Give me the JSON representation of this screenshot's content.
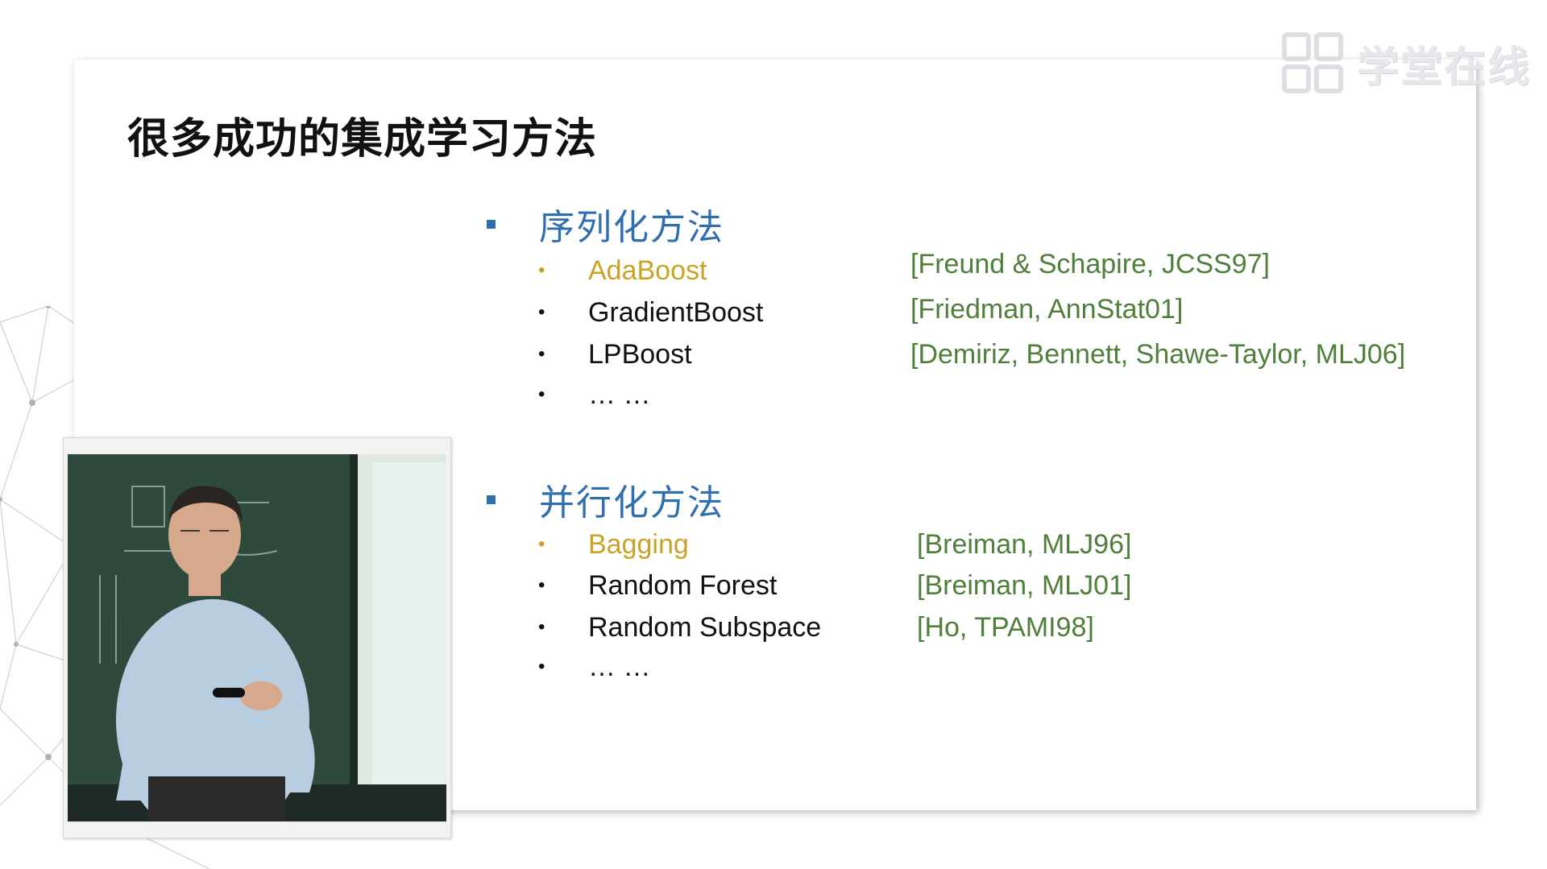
{
  "watermark": {
    "text": "学堂在线"
  },
  "slide": {
    "title": "很多成功的集成学习方法",
    "sections": [
      {
        "title": "序列化方法",
        "items": [
          {
            "label": "AdaBoost",
            "highlight": true,
            "ref": "[Freund & Schapire, JCSS97]"
          },
          {
            "label": "GradientBoost",
            "highlight": false,
            "ref": "[Friedman, AnnStat01]"
          },
          {
            "label": "LPBoost",
            "highlight": false,
            "ref": "[Demiriz, Bennett, Shawe-Taylor, MLJ06]"
          },
          {
            "label": "… …",
            "highlight": false,
            "ref": ""
          }
        ]
      },
      {
        "title": "并行化方法",
        "items": [
          {
            "label": "Bagging",
            "highlight": true,
            "ref": "[Breiman, MLJ96]"
          },
          {
            "label": "Random Forest",
            "highlight": false,
            "ref": "[Breiman, MLJ01]"
          },
          {
            "label": "Random Subspace",
            "highlight": false,
            "ref": "[Ho, TPAMI98]"
          },
          {
            "label": "… …",
            "highlight": false,
            "ref": ""
          }
        ]
      }
    ]
  },
  "colors": {
    "section_title": "#2f6fad",
    "highlight": "#c9a227",
    "reference": "#4f7f3a",
    "title": "#111111"
  }
}
